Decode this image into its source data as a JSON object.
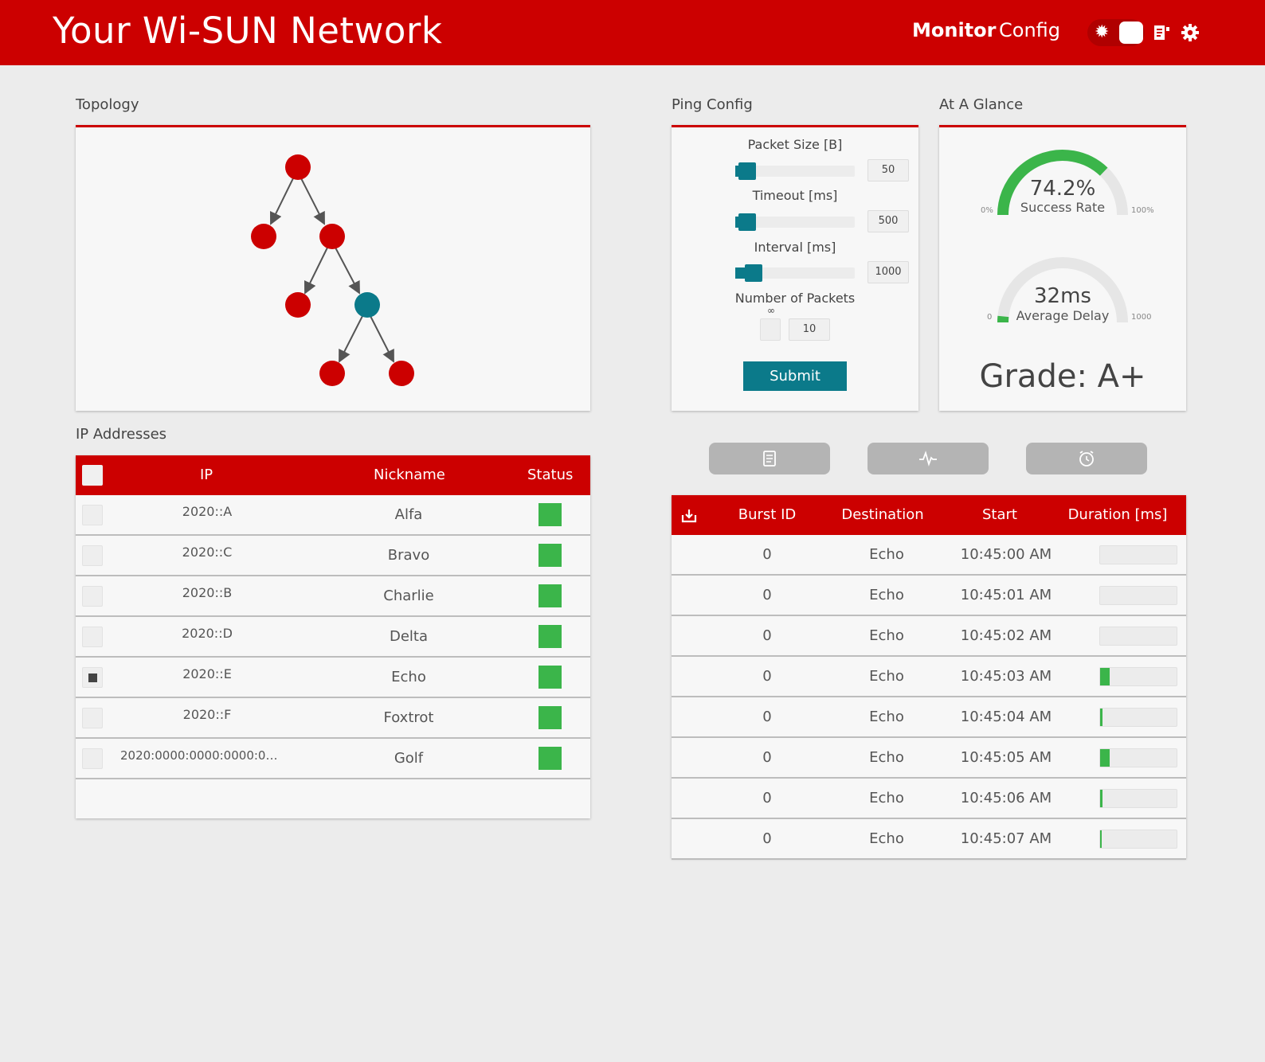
{
  "header": {
    "title": "Your Wi-SUN Network",
    "nav": {
      "monitor": "Monitor",
      "config": "Config"
    },
    "icons": {
      "theme_toggle": "sun-icon",
      "docs": "docs-icon",
      "settings": "gear-icon"
    },
    "accent": "#cc0000"
  },
  "topology": {
    "label": "Topology",
    "colors": {
      "node": "#cc0000",
      "selected": "#0b7a8a",
      "edge": "#555555"
    }
  },
  "ping_config": {
    "label": "Ping Config",
    "packet_size": {
      "label": "Packet Size [B]",
      "value": "50",
      "slider_fraction": 0.1
    },
    "timeout": {
      "label": "Timeout [ms]",
      "value": "500",
      "slider_fraction": 0.1
    },
    "interval": {
      "label": "Interval [ms]",
      "value": "1000",
      "slider_fraction": 0.15
    },
    "num_packets": {
      "label": "Number of Packets",
      "infinity": "∞",
      "value": "10"
    },
    "submit_label": "Submit"
  },
  "glance": {
    "label": "At A Glance",
    "success": {
      "value": "74.2%",
      "caption": "Success Rate",
      "min": "0%",
      "max": "100%",
      "fraction": 0.742
    },
    "delay": {
      "value": "32ms",
      "caption": "Average Delay",
      "min": "0",
      "max": "1000",
      "fraction": 0.032
    },
    "grade": "Grade: A+",
    "colors": {
      "gauge_fill": "#3bb54a",
      "gauge_track": "#e6e6e6"
    }
  },
  "ip_table": {
    "label": "IP Addresses",
    "headers": {
      "ip": "IP",
      "nickname": "Nickname",
      "status": "Status"
    },
    "rows": [
      {
        "ip": "2020::A",
        "nickname": "Alfa",
        "checked": false
      },
      {
        "ip": "2020::C",
        "nickname": "Bravo",
        "checked": false
      },
      {
        "ip": "2020::B",
        "nickname": "Charlie",
        "checked": false
      },
      {
        "ip": "2020::D",
        "nickname": "Delta",
        "checked": false
      },
      {
        "ip": "2020::E",
        "nickname": "Echo",
        "checked": true
      },
      {
        "ip": "2020::F",
        "nickname": "Foxtrot",
        "checked": false
      },
      {
        "ip": "2020:0000:0000:0000:0…",
        "nickname": "Golf",
        "checked": false
      }
    ],
    "status_color": "#3bb54a"
  },
  "action_buttons": [
    {
      "icon": "document-icon"
    },
    {
      "icon": "pulse-icon"
    },
    {
      "icon": "alarm-clock-icon"
    }
  ],
  "burst_table": {
    "headers": {
      "icon": "download-icon",
      "burst_id": "Burst ID",
      "destination": "Destination",
      "start": "Start",
      "duration": "Duration [ms]"
    },
    "rows": [
      {
        "burst_id": "0",
        "destination": "Echo",
        "start": "10:45:00 AM",
        "duration_fraction": 0.0
      },
      {
        "burst_id": "0",
        "destination": "Echo",
        "start": "10:45:01 AM",
        "duration_fraction": 0.0
      },
      {
        "burst_id": "0",
        "destination": "Echo",
        "start": "10:45:02 AM",
        "duration_fraction": 0.0
      },
      {
        "burst_id": "0",
        "destination": "Echo",
        "start": "10:45:03 AM",
        "duration_fraction": 0.12
      },
      {
        "burst_id": "0",
        "destination": "Echo",
        "start": "10:45:04 AM",
        "duration_fraction": 0.03
      },
      {
        "burst_id": "0",
        "destination": "Echo",
        "start": "10:45:05 AM",
        "duration_fraction": 0.12
      },
      {
        "burst_id": "0",
        "destination": "Echo",
        "start": "10:45:06 AM",
        "duration_fraction": 0.03
      },
      {
        "burst_id": "0",
        "destination": "Echo",
        "start": "10:45:07 AM",
        "duration_fraction": 0.02
      }
    ]
  }
}
